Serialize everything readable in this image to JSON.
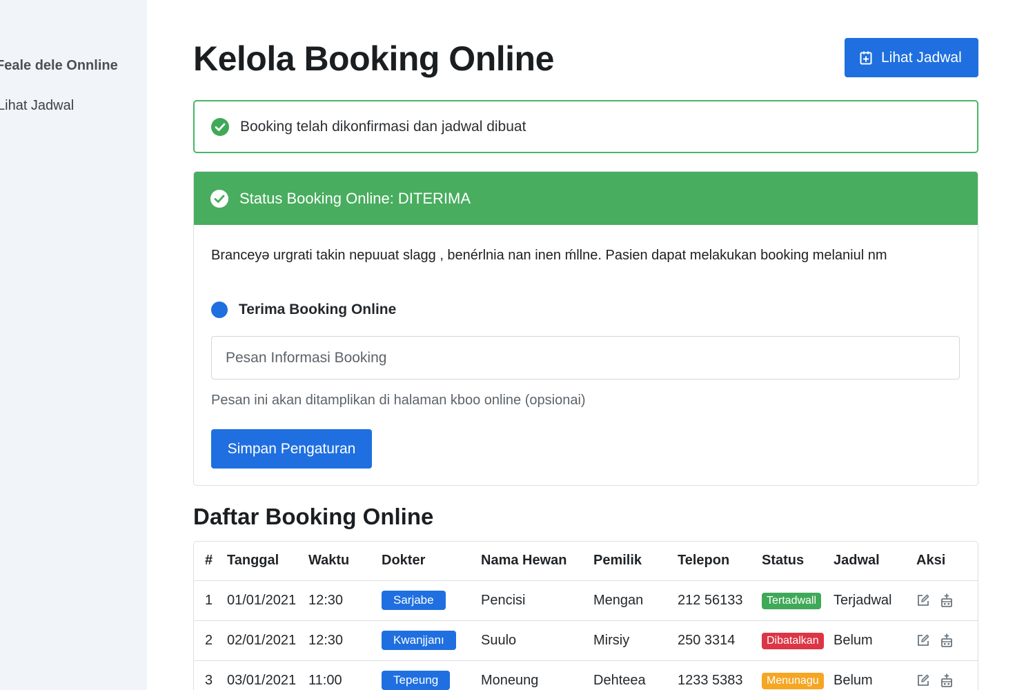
{
  "sidebar": {
    "items": [
      {
        "label": "Feale dele Onnline"
      },
      {
        "label": "Lihat Jadwal"
      }
    ]
  },
  "header": {
    "title": "Kelola Booking Online",
    "action_label": "Lihat Jadwal",
    "action_icon": "calendar-plus-icon"
  },
  "alert": {
    "text": "Booking telah dikonfirmasi dan jadwal dibuat",
    "icon": "check-circle-icon",
    "color": "#48b565"
  },
  "status_card": {
    "header_text": "Status Booking Online: DITERIMA",
    "header_color": "#48ad5e",
    "description": "Branceyə urgrati takin nepuuat slagg , benérlnia nan inen ḿllne. Pasien dapat melakukan booking melaniul nm",
    "toggle_label": "Terima Booking Online",
    "input_placeholder": "Pesan Informasi Booking",
    "input_value": "",
    "help_text": "Pesan ini akan ditamplikan di halaman kboo online (opsionai)",
    "save_label": "Simpan Pengaturan"
  },
  "bookings": {
    "title": "Daftar Booking Online",
    "columns": [
      "#",
      "Tanggal",
      "Waktu",
      "Dokter",
      "Nama Hewan",
      "Pemilik",
      "Telepon",
      "Status",
      "Jadwal",
      "Aksi"
    ],
    "rows": [
      {
        "no": "1",
        "date": "01/01/2021",
        "time": "12:30",
        "doctor": "Sarjabe",
        "pet": "Pencisi",
        "owner": "Mengan",
        "phone": "212 56133",
        "status": "Tertadwall",
        "status_color": "#3fa958",
        "schedule": "Terjadwal"
      },
      {
        "no": "2",
        "date": "02/01/2021",
        "time": "12:30",
        "doctor": "Kwanjjanı",
        "pet": "Suulo",
        "owner": "Mirsiy",
        "phone": "250 3314",
        "status": "Dibatalkan",
        "status_color": "#dc3545",
        "schedule": "Belum"
      },
      {
        "no": "3",
        "date": "03/01/2021",
        "time": "11:00",
        "doctor": "Tepeung",
        "pet": "Moneung",
        "owner": "Dehteea",
        "phone": "1233 5383",
        "status": "Menunagu",
        "status_color": "#f5a623",
        "schedule": "Belum"
      }
    ],
    "action_icons": [
      "edit-icon",
      "calendar-add-icon"
    ]
  },
  "colors": {
    "primary": "#1f6fe0",
    "success": "#48b565",
    "sidebar_bg": "#f1f4f8"
  }
}
